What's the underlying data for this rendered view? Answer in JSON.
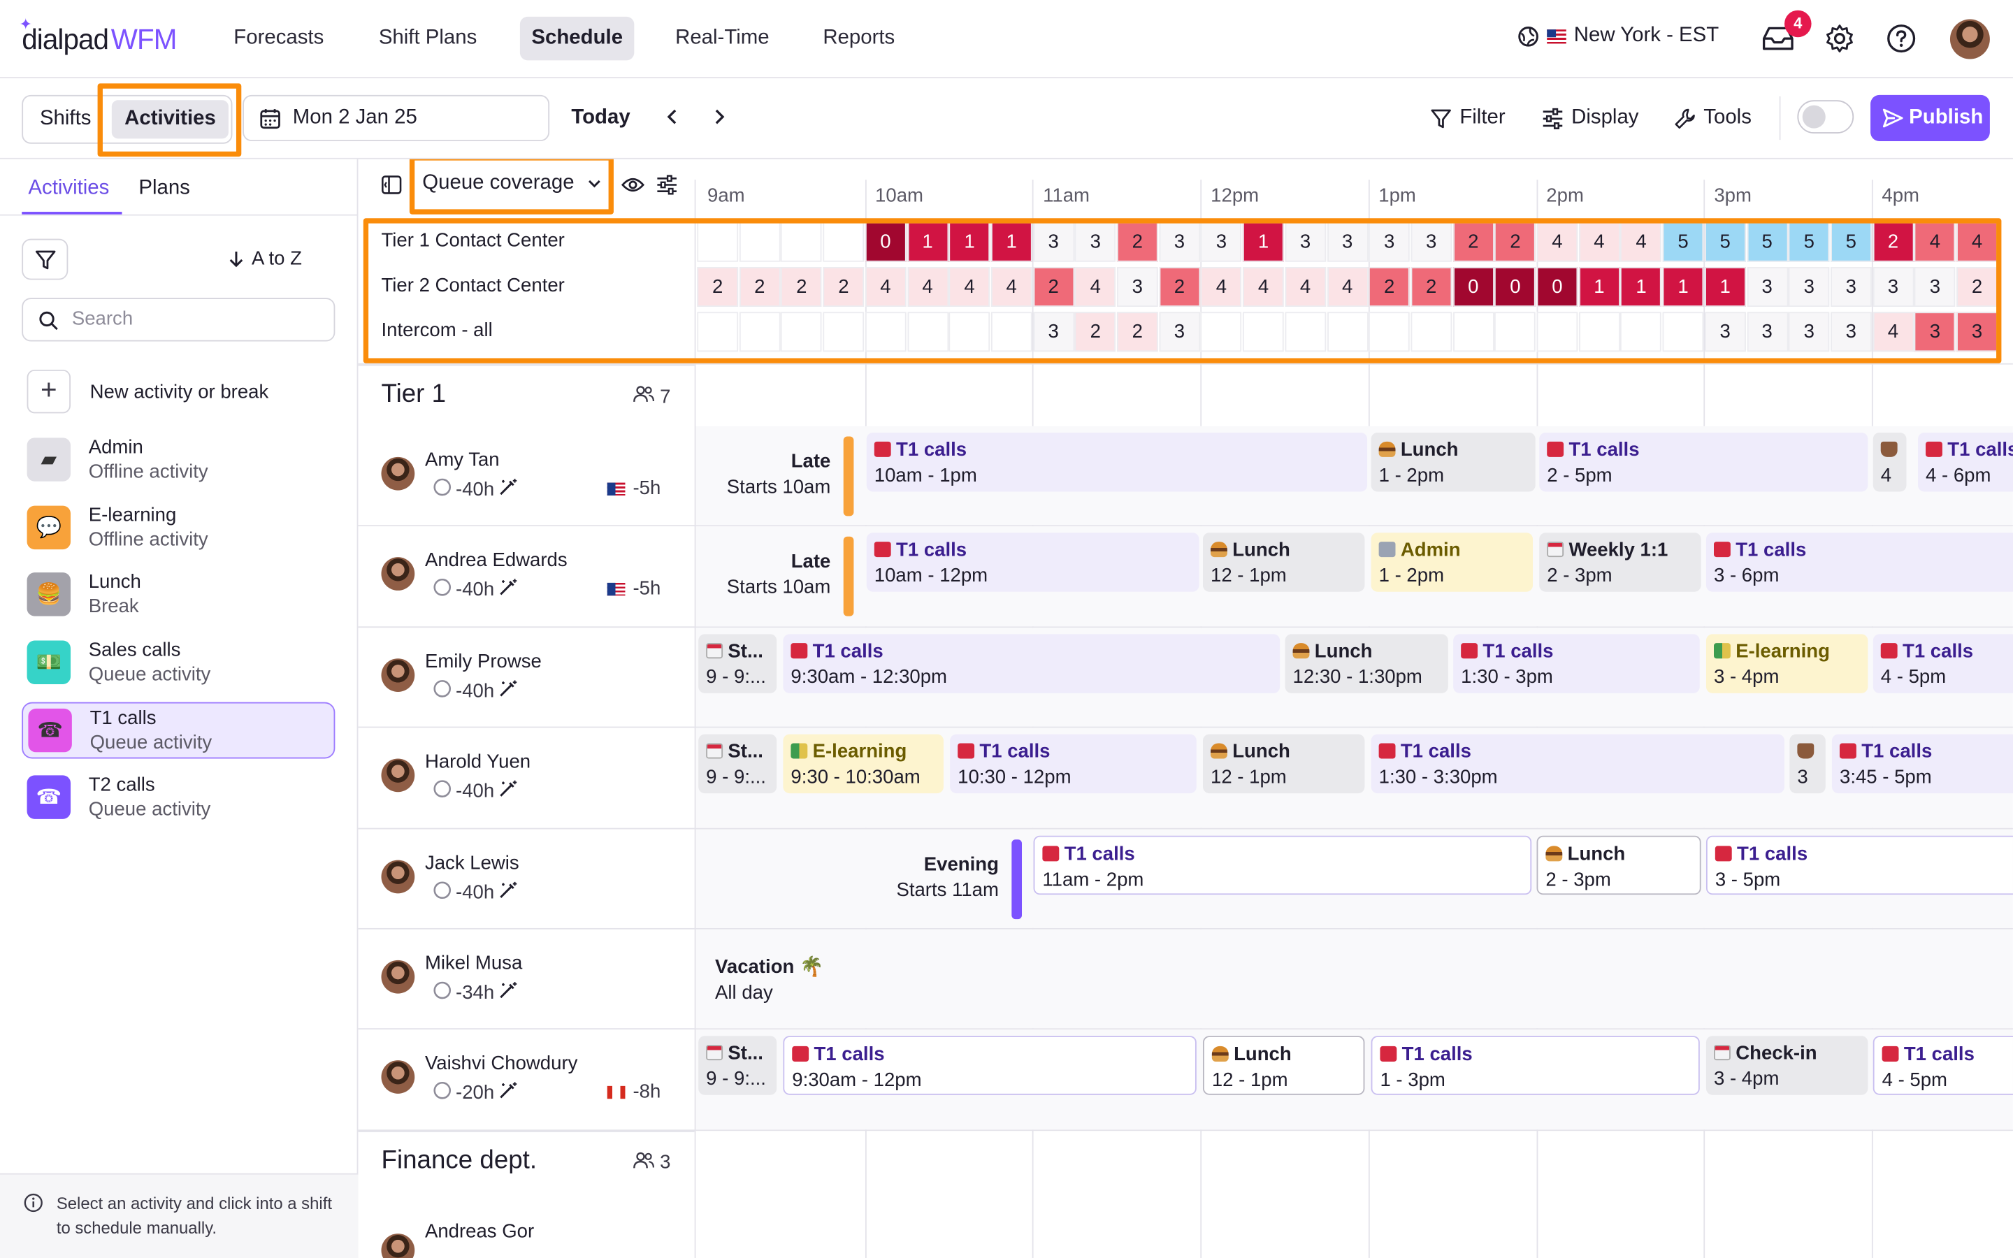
{
  "nav": {
    "brand_a": "dialpad",
    "brand_b": "WFM",
    "tabs": [
      "Forecasts",
      "Shift Plans",
      "Schedule",
      "Real-Time",
      "Reports"
    ],
    "active_tab": "Schedule",
    "timezone": "New York - EST",
    "inbox_count": "4"
  },
  "toolbar": {
    "shifts": "Shifts",
    "activities": "Activities",
    "date": "Mon 2 Jan 25",
    "today": "Today",
    "filter": "Filter",
    "display": "Display",
    "tools": "Tools",
    "publish": "Publish"
  },
  "left": {
    "tab_activities": "Activities",
    "tab_plans": "Plans",
    "sort": "A to Z",
    "search_placeholder": "Search",
    "new_activity": "New activity or break",
    "items": [
      {
        "name": "Admin",
        "sub": "Offline activity",
        "icon": "folder-icon",
        "bg": "#e1e0e6"
      },
      {
        "name": "E-learning",
        "sub": "Offline activity",
        "icon": "speech-bubble-icon",
        "bg": "#f8a23a"
      },
      {
        "name": "Lunch",
        "sub": "Break",
        "icon": "burger-icon",
        "bg": "#a3a2aa"
      },
      {
        "name": "Sales calls",
        "sub": "Queue activity",
        "icon": "money-icon",
        "bg": "#36d3c8"
      },
      {
        "name": "T1 calls",
        "sub": "Queue activity",
        "icon": "phone-icon",
        "bg": "#e255e8"
      },
      {
        "name": "T2 calls",
        "sub": "Queue activity",
        "icon": "telephone-icon",
        "bg": "#7c52ff"
      }
    ],
    "selected": "T1 calls",
    "footer": "Select an activity and click into a shift to schedule manually."
  },
  "coverage": {
    "selector": "Queue coverage",
    "hours": [
      "9am",
      "10am",
      "11am",
      "12pm",
      "1pm",
      "2pm",
      "3pm",
      "4pm"
    ],
    "rows": [
      {
        "name": "Tier 1 Contact Center",
        "values": [
          "",
          "",
          "",
          "",
          "0",
          "1",
          "1",
          "1",
          "3",
          "3",
          "2",
          "3",
          "3",
          "1",
          "3",
          "3",
          "3",
          "3",
          "2",
          "2",
          "4",
          "4",
          "4",
          "5",
          "5",
          "5",
          "5",
          "5",
          "2",
          "4",
          "4"
        ]
      },
      {
        "name": "Tier 2 Contact Center",
        "values": [
          "2",
          "2",
          "2",
          "2",
          "4",
          "4",
          "4",
          "4",
          "2",
          "4",
          "3",
          "2",
          "4",
          "4",
          "4",
          "4",
          "2",
          "2",
          "0",
          "0",
          "0",
          "1",
          "1",
          "1",
          "1",
          "3",
          "3",
          "3",
          "3",
          "3",
          "2"
        ]
      },
      {
        "name": "Intercom - all",
        "values": [
          "",
          "",
          "",
          "",
          "",
          "",
          "",
          "",
          "3",
          "2",
          "2",
          "3",
          "",
          "",
          "",
          "",
          "",
          "",
          "",
          "",
          "",
          "",
          "",
          "",
          "3",
          "3",
          "3",
          "3",
          "4",
          "3",
          "3"
        ]
      }
    ]
  },
  "groups": [
    {
      "title": "Tier 1",
      "count": "7"
    },
    {
      "title": "Finance dept.",
      "count": "3"
    }
  ],
  "people": [
    {
      "name": "Amy Tan",
      "hours": "-40h",
      "offset": "-5h",
      "flag": "us",
      "shift": "Late",
      "starts": "Starts 10am",
      "bar": "#f8a23a",
      "blocks": [
        {
          "t": "T1 calls",
          "s": "10am - 1pm",
          "k": "q",
          "i": "phone"
        },
        {
          "t": "Lunch",
          "s": "1 - 2pm",
          "k": "l",
          "i": "burger"
        },
        {
          "t": "T1 calls",
          "s": "2 - 5pm",
          "k": "q",
          "i": "phone"
        },
        {
          "t": "",
          "s": "4",
          "k": "g",
          "i": "cup"
        },
        {
          "t": "T1 calls",
          "s": "4 - 6pm",
          "k": "q",
          "i": "phone"
        }
      ]
    },
    {
      "name": "Andrea Edwards",
      "hours": "-40h",
      "offset": "-5h",
      "flag": "us",
      "shift": "Late",
      "starts": "Starts 10am",
      "bar": "#f8a23a",
      "blocks": [
        {
          "t": "T1 calls",
          "s": "10am - 12pm",
          "k": "q",
          "i": "phone"
        },
        {
          "t": "Lunch",
          "s": "12 - 1pm",
          "k": "l",
          "i": "burger"
        },
        {
          "t": "Admin",
          "s": "1 - 2pm",
          "k": "e",
          "i": "folder"
        },
        {
          "t": "Weekly 1:1",
          "s": "2 - 3pm",
          "k": "g",
          "i": "cal"
        },
        {
          "t": "T1 calls",
          "s": "3 - 6pm",
          "k": "q",
          "i": "phone"
        }
      ]
    },
    {
      "name": "Emily Prowse",
      "hours": "-40h",
      "offset": "",
      "flag": "",
      "shift": "",
      "starts": "",
      "bar": "",
      "blocks": [
        {
          "t": "St...",
          "s": "9 - 9:...",
          "k": "g",
          "i": "cal"
        },
        {
          "t": "T1 calls",
          "s": "9:30am - 12:30pm",
          "k": "q",
          "i": "phone"
        },
        {
          "t": "Lunch",
          "s": "12:30 - 1:30pm",
          "k": "l",
          "i": "burger"
        },
        {
          "t": "T1 calls",
          "s": "1:30 - 3pm",
          "k": "q",
          "i": "phone"
        },
        {
          "t": "E-learning",
          "s": "3 - 4pm",
          "k": "e",
          "i": "book"
        },
        {
          "t": "T1 calls",
          "s": "4 - 5pm",
          "k": "q",
          "i": "phone"
        }
      ]
    },
    {
      "name": "Harold Yuen",
      "hours": "-40h",
      "offset": "",
      "flag": "",
      "shift": "",
      "starts": "",
      "bar": "",
      "blocks": [
        {
          "t": "St...",
          "s": "9 - 9:...",
          "k": "g",
          "i": "cal"
        },
        {
          "t": "E-learning",
          "s": "9:30 - 10:30am",
          "k": "e",
          "i": "book"
        },
        {
          "t": "T1 calls",
          "s": "10:30 - 12pm",
          "k": "q",
          "i": "phone"
        },
        {
          "t": "Lunch",
          "s": "12 - 1pm",
          "k": "l",
          "i": "burger"
        },
        {
          "t": "T1 calls",
          "s": "1:30 - 3:30pm",
          "k": "q",
          "i": "phone"
        },
        {
          "t": "",
          "s": "3",
          "k": "g",
          "i": "cup"
        },
        {
          "t": "T1 calls",
          "s": "3:45 - 5pm",
          "k": "q",
          "i": "phone"
        }
      ]
    },
    {
      "name": "Jack Lewis",
      "hours": "-40h",
      "offset": "",
      "flag": "",
      "shift": "Evening",
      "starts": "Starts 11am",
      "bar": "#7c52ff",
      "blocks": [
        {
          "t": "T1 calls",
          "s": "11am - 2pm",
          "k": "qo",
          "i": "phone"
        },
        {
          "t": "Lunch",
          "s": "2 - 3pm",
          "k": "lo",
          "i": "burger"
        },
        {
          "t": "T1 calls",
          "s": "3 - 5pm",
          "k": "qo",
          "i": "phone"
        }
      ]
    },
    {
      "name": "Mikel Musa",
      "hours": "-34h",
      "offset": "",
      "flag": "",
      "shift": "",
      "starts": "",
      "bar": "",
      "vacation": "Vacation",
      "vacation_sub": "All day",
      "blocks": []
    },
    {
      "name": "Vaishvi Chowdury",
      "hours": "-20h",
      "offset": "-8h",
      "flag": "ca",
      "shift": "",
      "starts": "",
      "bar": "",
      "blocks": [
        {
          "t": "St...",
          "s": "9 - 9:...",
          "k": "g",
          "i": "cal"
        },
        {
          "t": "T1 calls",
          "s": "9:30am - 12pm",
          "k": "qo",
          "i": "phone"
        },
        {
          "t": "Lunch",
          "s": "12 - 1pm",
          "k": "lo",
          "i": "burger"
        },
        {
          "t": "T1 calls",
          "s": "1 - 3pm",
          "k": "qo",
          "i": "phone"
        },
        {
          "t": "Check-in",
          "s": "3 - 4pm",
          "k": "g",
          "i": "cal"
        },
        {
          "t": "T1 calls",
          "s": "4 - 5pm",
          "k": "qo",
          "i": "phone"
        }
      ]
    }
  ],
  "next_person": {
    "name": "Andreas Gor"
  }
}
